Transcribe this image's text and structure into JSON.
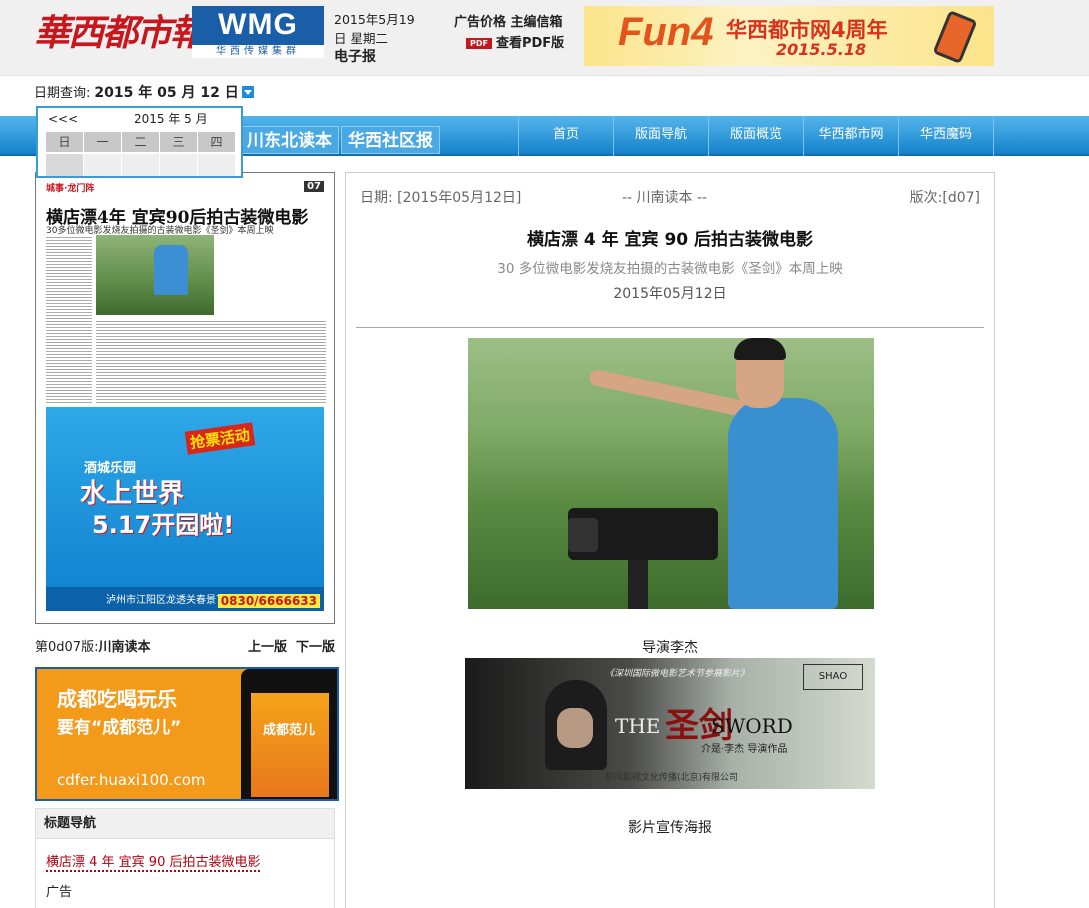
{
  "header": {
    "logo_text": "華西都市報",
    "wmg_big": "WMG",
    "wmg_small": "华西传媒集群",
    "date_line1": "2015年5月19",
    "date_line2": "日 星期二",
    "date_line3": "电子报",
    "link_ad_price": "广告价格",
    "link_editor_mail": "主编信箱",
    "pdf_badge": "PDF",
    "link_view_pdf": "查看PDF版",
    "banner": {
      "f4": "Fun4",
      "text1": "华西都市网4周年",
      "text2": "2015.5.18"
    }
  },
  "date_query": {
    "label": "日期查询:",
    "value": "2015 年 05 月 12 日"
  },
  "calendar": {
    "prev": "<<<",
    "title": "2015 年 5 月",
    "weekdays": [
      "日",
      "一",
      "二",
      "三",
      "四"
    ]
  },
  "nav": {
    "tabs": [
      "川东北读本",
      "华西社区报"
    ],
    "menu": [
      "首页",
      "版面导航",
      "版面概览",
      "华西都市网",
      "华西魔码"
    ]
  },
  "thumbnail": {
    "masthead": "城事·龙门阵",
    "page_num": "07",
    "headline": "横店漂4年 宜宾90后拍古装微电影",
    "sub": "30多位微电影发烧友拍摄的古装微电影《圣剑》本周上映",
    "ad_c1": "酒城乐园",
    "ad_c2": "水上世界",
    "ad_c3": "5.17开园啦!",
    "ad_c4": "抢票活动",
    "ad_addr": "泸州市江阳区龙透关春景下路",
    "ad_tel": "0830/6666633"
  },
  "page_nav": {
    "prefix": "第0d07版:",
    "name": "川南读本",
    "prev": "上一版",
    "next": "下一版"
  },
  "side_ad": {
    "line1": "成都吃喝玩乐",
    "line2": "要有“成都范儿”",
    "line3": "cdfer.huaxi100.com",
    "screen_name": "成都范儿"
  },
  "headline_nav": {
    "title": "标题导航",
    "items": [
      "横店漂 4 年 宜宾 90 后拍古装微电影",
      "广告"
    ]
  },
  "article": {
    "date": "日期: [2015年05月12日]",
    "section": "-- 川南读本 --",
    "edition": "版次:[d07]",
    "title": "横店漂 4 年 宜宾 90 后拍古装微电影",
    "subtitle": "30 多位微电影发烧友拍摄的古装微电影《圣剑》本周上映",
    "pubdate": "2015年05月12日",
    "caption1": "导演李杰",
    "caption2": "影片宣传海报",
    "poster": {
      "top": "《深圳国际微电影艺术节参展影片》",
      "the": "THE",
      "sword": "SWORD",
      "cn": "圣剑",
      "credit": "介是·李杰 导演作品",
      "bottom": "郁风影视文化传播(北京)有限公司",
      "logo": "SHAO"
    }
  },
  "colors": {
    "brand_red": "#c8161d",
    "nav_blue": "#1482cc",
    "link_red": "#b5000f"
  }
}
